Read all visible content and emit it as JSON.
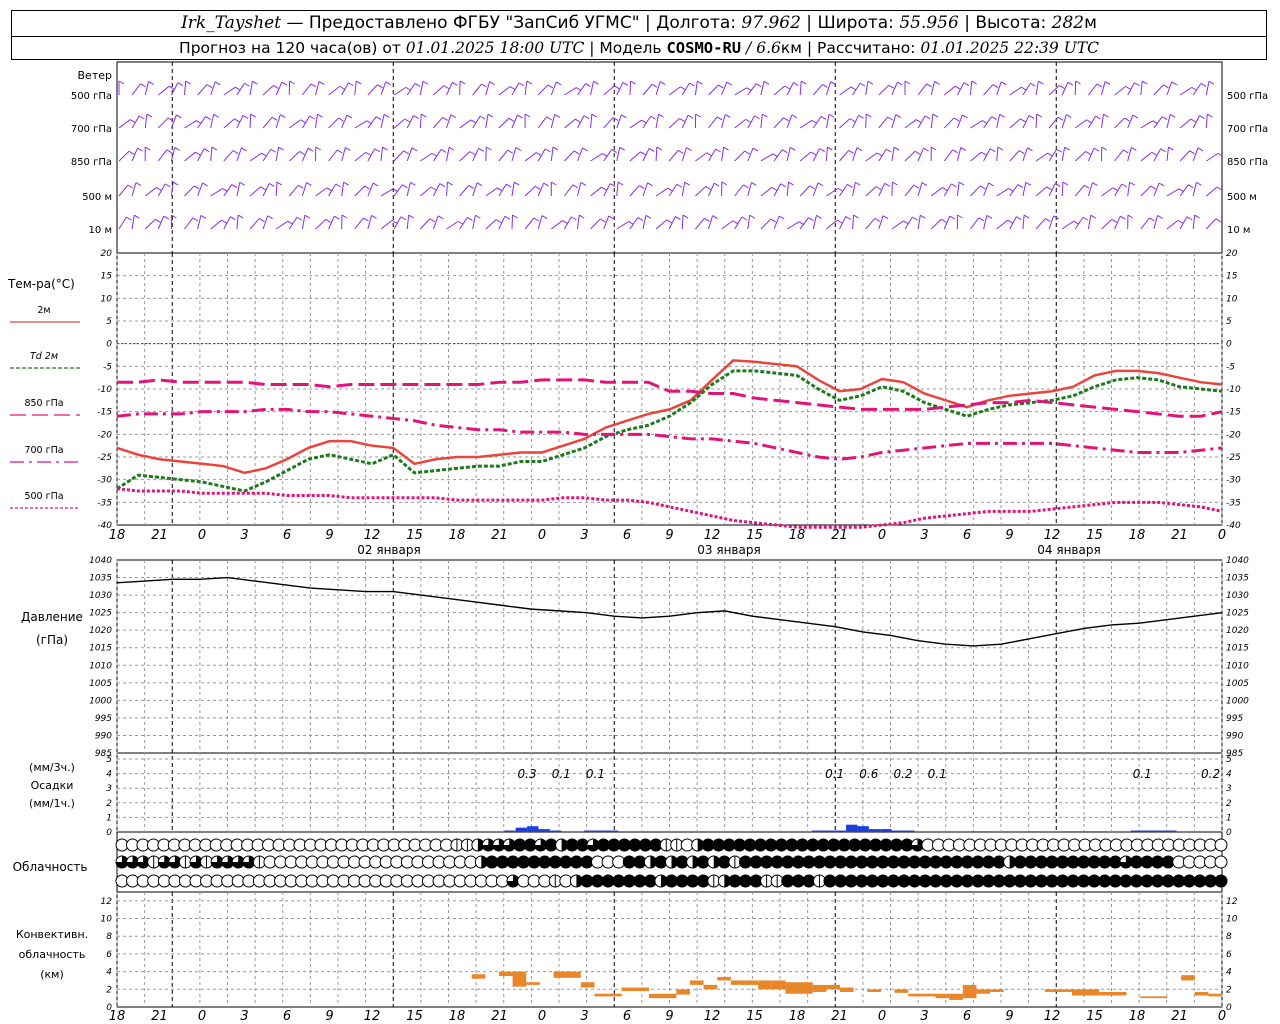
{
  "header": {
    "station": "Irk_Tayshet",
    "provider": " — Предоставлено ФГБУ \"ЗапСиб УГМС\" | Долгота: ",
    "lon": "97.962",
    "lat_label": " | Широта: ",
    "lat": "55.956",
    "alt_label": " | Высота: ",
    "alt": "282",
    "alt_unit": "м",
    "forecast_prefix": "Прогноз на 120 часа(ов) от ",
    "init_time": "01.01.2025 18:00 UTC",
    "model_label": "  | Модель ",
    "model": "COSMO-RU",
    "model_res": " / 6.6",
    "model_res_unit": "км",
    "calc_label": " | Рассчитано: ",
    "calc_time": "01.01.2025 22:39 UTC"
  },
  "colors": {
    "wind": "#8a2be2",
    "t2m": "#e8453c",
    "td2m": "#1e7a1e",
    "t850": "#e0147a",
    "t700": "#e0147a",
    "t500": "#e0147a",
    "zero_line": "#2244cc",
    "pressure": "#000000",
    "precip": "#1f3fd8",
    "convective": "#e8862a",
    "grid": "#999999"
  },
  "wind_panel": {
    "title": "Ветер",
    "levels": [
      "500 гПа",
      "700 гПа",
      "850 гПа",
      "500 м",
      "10  м"
    ]
  },
  "temp_panel": {
    "title": "Тем-ра(°C)",
    "legend": [
      {
        "label": "2м"
      },
      {
        "label": "Td  2м",
        "italic_prefix": "Td"
      },
      {
        "label": "850 гПа"
      },
      {
        "label": "700 гПа"
      },
      {
        "label": "500 гПа"
      }
    ]
  },
  "pressure_panel": {
    "title": "Давление",
    "unit": "(гПа)"
  },
  "precip_panel": {
    "unit1": "(мм/3ч.)",
    "title": "Осадки",
    "unit2": "(мм/1ч.)"
  },
  "cloud_panel": {
    "title": "Облачность"
  },
  "conv_panel": {
    "title1": "Конвективн.",
    "title2": "облачность",
    "unit": "(км)"
  },
  "x_axis": {
    "ticks": [
      "18",
      "21",
      "0",
      "3",
      "6",
      "9",
      "12",
      "15",
      "18",
      "21",
      "0",
      "3",
      "6",
      "9",
      "12",
      "15",
      "18",
      "21",
      "0",
      "3",
      "6",
      "9",
      "12",
      "15",
      "18",
      "21",
      "0"
    ],
    "days": [
      "02 января",
      "03 января",
      "04 января"
    ]
  },
  "chart_data": [
    {
      "type": "line",
      "title": "Тем-ра(°C)",
      "x_hours": [
        0,
        1.5,
        3,
        4.5,
        6,
        7.5,
        9,
        10.5,
        12,
        13.5,
        15,
        16.5,
        18,
        19.5,
        21,
        22.5,
        24,
        25.5,
        27,
        28.5,
        30,
        31.5,
        33,
        34.5,
        36,
        37.5,
        39,
        40.5,
        42,
        43.5,
        45,
        46.5,
        48,
        49.5,
        51,
        52.5,
        54,
        55.5,
        57,
        58.5,
        60,
        61.5,
        63,
        64.5,
        66,
        67.5,
        69,
        70.5,
        72,
        73.5,
        75,
        76.5,
        78
      ],
      "ylim": [
        -40,
        20
      ],
      "yticks": [
        20,
        15,
        10,
        5,
        0,
        -5,
        -10,
        -15,
        -20,
        -25,
        -30,
        -35,
        -40
      ],
      "series": [
        {
          "name": "2м",
          "key": "t2m",
          "style": "solid",
          "values": [
            -23,
            -24.5,
            -25.5,
            -26,
            -26.5,
            -27,
            -28.5,
            -27.5,
            -25.5,
            -23,
            -21.5,
            -21.5,
            -22.5,
            -23,
            -26.5,
            -25.5,
            -25,
            -25,
            -24.5,
            -24,
            -24,
            -22.5,
            -21,
            -18.5,
            -17,
            -15.5,
            -14.5,
            -12.5,
            -8,
            -3.7,
            -4,
            -4.5,
            -5,
            -8,
            -10.5,
            -10,
            -7.8,
            -8.5,
            -11,
            -12.5,
            -14,
            -12.5,
            -11.5,
            -11,
            -10.5,
            -9.5,
            -7,
            -6,
            -6,
            -6.5,
            -7.5,
            -8.5,
            -9
          ]
        },
        {
          "name": "Td  2м",
          "key": "td2m",
          "style": "dashed",
          "values": [
            -32,
            -29,
            -29.5,
            -30,
            -30.5,
            -31.5,
            -32.5,
            -30.5,
            -28,
            -25.5,
            -24.5,
            -25.5,
            -26.5,
            -24.5,
            -28.5,
            -28,
            -27.5,
            -27,
            -27,
            -26,
            -26,
            -24.5,
            -23,
            -20.5,
            -19,
            -18,
            -16,
            -13,
            -9,
            -6,
            -6,
            -6.5,
            -7,
            -10,
            -12.5,
            -11.5,
            -9.5,
            -10.5,
            -13,
            -14.5,
            -16,
            -14.5,
            -13.5,
            -13,
            -12.5,
            -11.5,
            -9.5,
            -8,
            -7.5,
            -8,
            -9.5,
            -10,
            -10.5
          ]
        },
        {
          "name": "850 гПа",
          "key": "t850",
          "style": "longdash",
          "values": [
            -8.5,
            -8.5,
            -8,
            -8.5,
            -8.5,
            -8.5,
            -8.5,
            -9,
            -9,
            -9,
            -9.5,
            -9,
            -9,
            -9,
            -9,
            -9,
            -9,
            -9,
            -8.5,
            -8.5,
            -8,
            -8,
            -8,
            -8.5,
            -8.5,
            -8.5,
            -10.5,
            -10.5,
            -11,
            -11,
            -12,
            -12.5,
            -13,
            -13.5,
            -14,
            -14.5,
            -14.5,
            -14.5,
            -14.5,
            -14,
            -13.5,
            -13,
            -13,
            -12.5,
            -13,
            -13.5,
            -14,
            -14.5,
            -15,
            -15.5,
            -16,
            -16,
            -15
          ]
        },
        {
          "name": "700 гПа",
          "key": "t700",
          "style": "dashdot",
          "values": [
            -16,
            -15.5,
            -15.5,
            -15.5,
            -15,
            -15,
            -15,
            -14.5,
            -14.5,
            -15,
            -15,
            -15.5,
            -16,
            -16.5,
            -17,
            -18,
            -18.5,
            -19,
            -19,
            -19.5,
            -19.5,
            -19.5,
            -20,
            -20,
            -20,
            -20,
            -20.5,
            -21,
            -21,
            -21.5,
            -22,
            -23,
            -24,
            -25,
            -25.5,
            -25,
            -24,
            -23.5,
            -23,
            -22.5,
            -22,
            -22,
            -22,
            -22,
            -22,
            -22.5,
            -23,
            -23.5,
            -24,
            -24,
            -24,
            -23.5,
            -23
          ]
        },
        {
          "name": "500 гПа",
          "key": "t500",
          "style": "dotted",
          "values": [
            -32,
            -32.5,
            -32.5,
            -32.5,
            -33,
            -33,
            -33,
            -33,
            -33.5,
            -33.5,
            -33.5,
            -34,
            -34,
            -34,
            -34,
            -34,
            -34.5,
            -34.5,
            -34.5,
            -34.5,
            -34.5,
            -34,
            -34,
            -34.5,
            -34.5,
            -35,
            -36,
            -37,
            -38,
            -39,
            -39.5,
            -40,
            -40.5,
            -41,
            -41,
            -40.5,
            -40,
            -39.5,
            -38.5,
            -38,
            -37.5,
            -37,
            -37,
            -37,
            -36.5,
            -36,
            -35.5,
            -35,
            -35,
            -35,
            -35.5,
            -36,
            -37
          ]
        }
      ]
    },
    {
      "type": "line",
      "title": "Давление",
      "ylabel": "(гПа)",
      "ylim": [
        985,
        1040
      ],
      "yticks": [
        1040,
        1035,
        1030,
        1025,
        1020,
        1015,
        1010,
        1005,
        1000,
        995,
        990,
        985
      ],
      "x_hours": [
        0,
        3,
        6,
        9,
        12,
        15,
        18,
        21,
        24,
        27,
        30,
        33,
        36,
        39,
        42,
        45,
        48,
        51,
        54,
        57,
        60,
        63,
        66,
        69,
        72,
        75,
        78,
        81,
        84,
        87,
        90,
        93,
        96,
        99,
        102,
        105,
        108,
        111,
        114,
        117,
        120
      ],
      "series": [
        {
          "name": "Давление",
          "key": "pressure",
          "values": [
            1033.5,
            1034,
            1034.5,
            1034.5,
            1035,
            1034,
            1033,
            1032,
            1031.5,
            1031,
            1031,
            1030,
            1029,
            1028,
            1027,
            1026,
            1025.5,
            1025,
            1024,
            1023.5,
            1024,
            1025,
            1025.5,
            1024,
            1023,
            1022,
            1021,
            1019.5,
            1018.5,
            1017,
            1016,
            1015.5,
            1016,
            1017.5,
            1019,
            1020.5,
            1021.5,
            1022,
            1023,
            1024,
            1025
          ]
        }
      ]
    },
    {
      "type": "bar",
      "title": "Осадки",
      "ylim": [
        0,
        5
      ],
      "yticks": [
        5,
        4,
        3,
        2,
        1,
        0
      ],
      "labels_3h": [
        {
          "hour": 36,
          "text": "0.3"
        },
        {
          "hour": 39,
          "text": "0.1"
        },
        {
          "hour": 42,
          "text": "0.1"
        },
        {
          "hour": 63,
          "text": "0.1"
        },
        {
          "hour": 66,
          "text": "0.6"
        },
        {
          "hour": 69,
          "text": "0.2"
        },
        {
          "hour": 72,
          "text": "0.1"
        },
        {
          "hour": 90,
          "text": "0.1"
        },
        {
          "hour": 96,
          "text": "0.2"
        }
      ],
      "bars_1h": [
        [
          34,
          0.1
        ],
        [
          35,
          0.3
        ],
        [
          36,
          0.4
        ],
        [
          37,
          0.2
        ],
        [
          38,
          0.1
        ],
        [
          41,
          0.1
        ],
        [
          42,
          0.1
        ],
        [
          43,
          0.1
        ],
        [
          61,
          0.1
        ],
        [
          62,
          0.1
        ],
        [
          63,
          0.1
        ],
        [
          64,
          0.5
        ],
        [
          65,
          0.4
        ],
        [
          66,
          0.2
        ],
        [
          67,
          0.2
        ],
        [
          68,
          0.1
        ],
        [
          69,
          0.1
        ],
        [
          75,
          0.05
        ],
        [
          76,
          0.05
        ],
        [
          80,
          0.05
        ],
        [
          83,
          0.05
        ],
        [
          84,
          0.05
        ],
        [
          85,
          0.05
        ],
        [
          86,
          0.05
        ],
        [
          89,
          0.1
        ],
        [
          90,
          0.1
        ],
        [
          91,
          0.1
        ],
        [
          92,
          0.1
        ]
      ]
    },
    {
      "type": "table",
      "title": "Облачность",
      "note": "Cloud-cover symbols per hour (0..4 = octant fill quarters), 3 rows",
      "rows": [
        [
          0,
          0,
          0,
          0,
          0,
          0,
          0,
          0,
          0,
          0,
          0,
          0,
          0,
          0,
          0,
          0,
          0,
          0,
          0,
          0,
          0,
          0,
          0,
          0,
          0,
          0,
          0,
          0,
          0,
          0,
          0,
          0,
          1,
          1,
          2,
          3,
          3,
          3,
          4,
          4,
          3,
          4,
          2,
          4,
          4,
          3,
          4,
          4,
          4,
          4,
          4,
          4,
          1,
          1,
          0,
          2,
          4,
          4,
          4,
          4,
          4,
          4,
          4,
          4,
          4,
          4,
          4,
          4,
          4,
          4,
          4,
          4,
          4,
          4,
          4,
          4,
          3,
          0,
          0,
          0,
          0,
          0,
          0,
          0,
          0,
          0,
          0,
          0,
          0,
          0,
          0,
          0,
          0,
          0,
          0,
          0,
          0,
          0,
          0,
          0,
          0,
          0,
          0,
          0,
          0,
          0
        ],
        [
          3,
          3,
          3,
          1,
          3,
          3,
          1,
          3,
          1,
          3,
          3,
          3,
          3,
          1,
          0,
          0,
          0,
          0,
          0,
          0,
          0,
          0,
          0,
          0,
          0,
          0,
          0,
          0,
          0,
          0,
          0,
          0,
          0,
          0,
          2,
          4,
          4,
          4,
          4,
          4,
          4,
          4,
          4,
          4,
          4,
          0,
          0,
          0,
          4,
          4,
          2,
          4,
          2,
          4,
          2,
          4,
          2,
          4,
          1,
          4,
          4,
          4,
          4,
          4,
          4,
          4,
          4,
          4,
          4,
          4,
          4,
          4,
          4,
          4,
          4,
          4,
          4,
          4,
          4,
          4,
          4,
          4,
          4,
          4,
          2,
          4,
          4,
          4,
          4,
          4,
          4,
          4,
          4,
          4,
          4,
          3,
          4,
          4,
          4,
          4,
          0,
          0,
          0,
          0,
          0
        ],
        [
          0,
          0,
          0,
          0,
          0,
          0,
          0,
          0,
          0,
          0,
          0,
          0,
          0,
          0,
          0,
          0,
          0,
          0,
          0,
          0,
          0,
          0,
          0,
          0,
          0,
          0,
          0,
          0,
          0,
          0,
          0,
          0,
          0,
          0,
          0,
          0,
          0,
          3,
          0,
          0,
          0,
          1,
          0,
          2,
          4,
          4,
          4,
          4,
          4,
          4,
          4,
          2,
          4,
          4,
          4,
          4,
          1,
          2,
          4,
          4,
          4,
          1,
          1,
          4,
          4,
          4,
          1,
          4,
          4,
          4,
          4,
          4,
          4,
          4,
          4,
          4,
          4,
          4,
          4,
          4,
          4,
          4,
          4,
          4,
          4,
          4,
          4,
          4,
          4,
          4,
          4,
          4,
          4,
          4,
          4,
          4,
          4,
          4,
          4,
          4,
          4,
          4,
          4,
          4,
          4
        ]
      ]
    },
    {
      "type": "bar",
      "title": "Конвективн. облачность",
      "ylabel": "(км)",
      "ylim": [
        0,
        13
      ],
      "yticks": [
        12,
        10,
        8,
        6,
        4,
        2,
        0
      ],
      "segments": [
        [
          26,
          27,
          3.2,
          3.7
        ],
        [
          28,
          29,
          3.5,
          4
        ],
        [
          29,
          30,
          2.3,
          4
        ],
        [
          30,
          31,
          2.5,
          2.8
        ],
        [
          32,
          34,
          3.3,
          4
        ],
        [
          34,
          35,
          2.2,
          2.8
        ],
        [
          35,
          37,
          1.2,
          1.5
        ],
        [
          37,
          39,
          1.8,
          2.2
        ],
        [
          39,
          41,
          1.0,
          1.5
        ],
        [
          41,
          42,
          1.4,
          2
        ],
        [
          42,
          43,
          2.5,
          3
        ],
        [
          43,
          44,
          2,
          2.5
        ],
        [
          44,
          45,
          3,
          3.4
        ],
        [
          45,
          46,
          2.5,
          3
        ],
        [
          46,
          47,
          2.5,
          3
        ],
        [
          47,
          48,
          2,
          3
        ],
        [
          48,
          49,
          2,
          3
        ],
        [
          49,
          51,
          1.5,
          2.8
        ],
        [
          51,
          52,
          1.7,
          2.5
        ],
        [
          52,
          53,
          2,
          2.5
        ],
        [
          53,
          54,
          1.7,
          2.2
        ],
        [
          55,
          56,
          1.7,
          2
        ],
        [
          57,
          58,
          1.6,
          2
        ],
        [
          58,
          59,
          1.2,
          1.5
        ],
        [
          59,
          60,
          1.2,
          1.5
        ],
        [
          60,
          61,
          1.0,
          1.5
        ],
        [
          61,
          62,
          0.8,
          1.5
        ],
        [
          62,
          63,
          1,
          2.5
        ],
        [
          63,
          64,
          1.5,
          2
        ],
        [
          64,
          65,
          1.7,
          2
        ],
        [
          68,
          70,
          1.7,
          2
        ],
        [
          70,
          72,
          1.3,
          2
        ],
        [
          72,
          74,
          1.3,
          1.7
        ],
        [
          75,
          77,
          1,
          1.2
        ],
        [
          78,
          79,
          3,
          3.6
        ],
        [
          79,
          80,
          1.3,
          1.7
        ],
        [
          80,
          81,
          1.2,
          1.5
        ]
      ]
    }
  ]
}
